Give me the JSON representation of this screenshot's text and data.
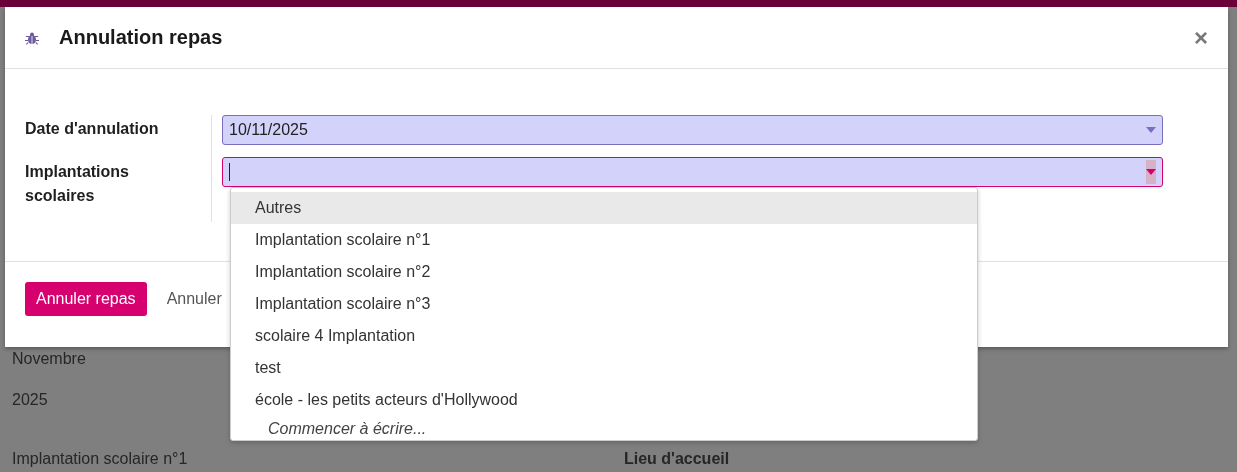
{
  "background": {
    "month": "Novembre",
    "year": "2025",
    "columns": [
      "Implantation scolaire n°1",
      "Lieu d'accueil"
    ]
  },
  "dialog": {
    "title": "Annulation repas",
    "close": "×",
    "fields": [
      {
        "label": "Date d'annulation",
        "kind": "date",
        "value": "10/11/2025",
        "focused": false
      },
      {
        "label": "Implantations scolaires",
        "kind": "tags",
        "focused": true
      }
    ],
    "dropdown": {
      "items": [
        {
          "label": "Autres",
          "selected": true
        },
        {
          "label": "Implantation scolaire n°1",
          "selected": false
        },
        {
          "label": "Implantation scolaire n°2",
          "selected": false
        },
        {
          "label": "Implantation scolaire n°3",
          "selected": false
        },
        {
          "label": "scolaire 4 Implantation",
          "selected": false
        },
        {
          "label": "test",
          "selected": false
        },
        {
          "label": "école - les petits acteurs d'Hollywood",
          "selected": false
        }
      ],
      "hint": "Commencer à écrire..."
    },
    "buttons": [
      {
        "label": "Annuler repas",
        "kind": "primary"
      },
      {
        "label": "Annuler",
        "kind": "secondary"
      }
    ]
  }
}
